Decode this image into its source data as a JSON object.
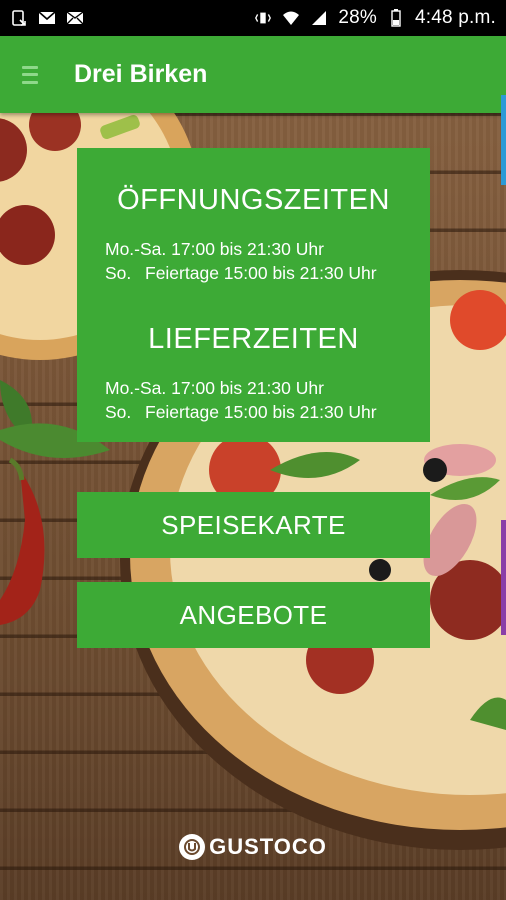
{
  "status_bar": {
    "battery": "28%",
    "time": "4:48 p.m."
  },
  "app_bar": {
    "title": "Drei Birken"
  },
  "opening_hours": {
    "title": "ÖFFNUNGSZEITEN",
    "rows": [
      {
        "day": "Mo.-Sa.",
        "hours": "17:00 bis 21:30 Uhr"
      },
      {
        "day": "So.",
        "hours": "Feiertage 15:00 bis 21:30 Uhr"
      }
    ]
  },
  "delivery_hours": {
    "title": "LIEFERZEITEN",
    "rows": [
      {
        "day": "Mo.-Sa.",
        "hours": "17:00 bis 21:30 Uhr"
      },
      {
        "day": "So.",
        "hours": "Feiertage 15:00 bis 21:30 Uhr"
      }
    ]
  },
  "buttons": {
    "menu": "SPEISEKARTE",
    "offers": "ANGEBOTE"
  },
  "footer": {
    "brand": "GUSTOCO"
  },
  "colors": {
    "accent": "#3daa36",
    "status_bar": "#000000"
  }
}
